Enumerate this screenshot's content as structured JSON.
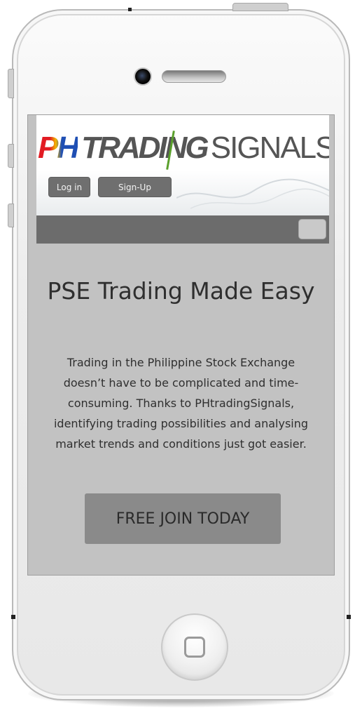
{
  "header": {
    "logo": {
      "ph": "PH",
      "trading": "TRADING",
      "signals": "SIGNALS",
      "brand_colors": [
        "#e21b23",
        "#f2b700",
        "#1f4fb4",
        "#555555",
        "#5aa02c"
      ]
    },
    "login_label": "Log in",
    "signup_label": "Sign-Up"
  },
  "nav": {
    "menu_icon": "menu-toggle-icon"
  },
  "hero": {
    "title": "PSE Trading Made Easy",
    "description": "Trading in the Philippine Stock Exchange doesn’t have to be complicated and time-consuming. Thanks to PHtradingSignals, identifying trading possibilities and analysing market trends and conditions just got easier.",
    "cta_label": "FREE JOIN TODAY"
  },
  "device": {
    "home_icon": "home-button-icon",
    "camera_icon": "camera-icon",
    "speaker_icon": "speaker-icon"
  }
}
